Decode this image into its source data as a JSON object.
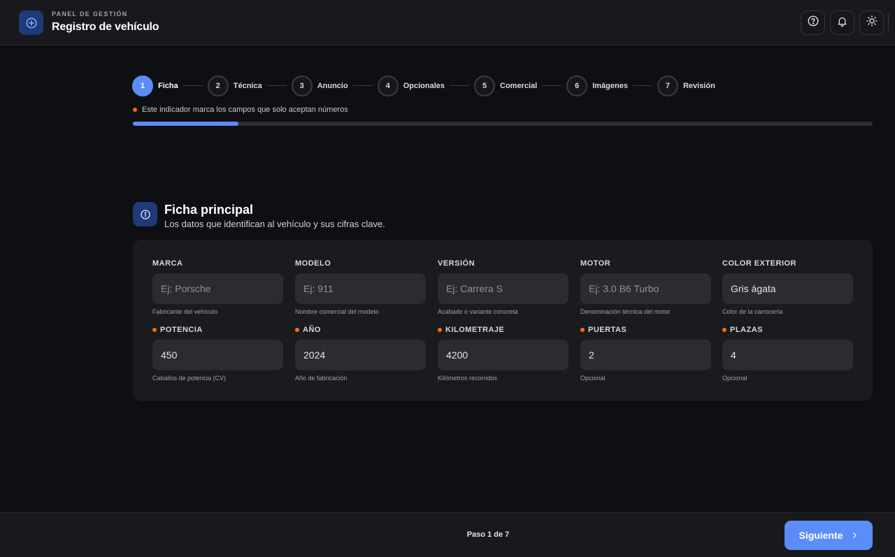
{
  "header": {
    "eyebrow": "PANEL DE GESTIÓN",
    "title": "Registro de vehículo",
    "brand_icon": "plus-circle-icon",
    "actions": [
      {
        "name": "help-button",
        "icon": "help-circle-icon"
      },
      {
        "name": "notifications-button",
        "icon": "bell-icon"
      },
      {
        "name": "theme-toggle-button",
        "icon": "sun-icon"
      }
    ]
  },
  "stepper": {
    "steps": [
      {
        "number": "1",
        "label": "Ficha"
      },
      {
        "number": "2",
        "label": "Técnica"
      },
      {
        "number": "3",
        "label": "Anuncio"
      },
      {
        "number": "4",
        "label": "Opcionales"
      },
      {
        "number": "5",
        "label": "Comercial"
      },
      {
        "number": "6",
        "label": "Imágenes"
      },
      {
        "number": "7",
        "label": "Revisión"
      }
    ],
    "active_index": 0
  },
  "hint": "Este indicador marca los campos que solo aceptan números",
  "progress": {
    "fraction": 0.143
  },
  "section": {
    "icon": "info-icon",
    "title": "Ficha principal",
    "subtitle": "Los datos que identifican al vehículo y sus cifras clave."
  },
  "fields": {
    "marca": {
      "label": "MARCA",
      "numeric": false,
      "value": "",
      "placeholder": "Ej: Porsche",
      "help": "Fabricante del vehículo"
    },
    "modelo": {
      "label": "MODELO",
      "numeric": false,
      "value": "",
      "placeholder": "Ej: 911",
      "help": "Nombre comercial del modelo"
    },
    "version": {
      "label": "VERSIÓN",
      "numeric": false,
      "value": "",
      "placeholder": "Ej: Carrera S",
      "help": "Acabado o variante concreta"
    },
    "motor": {
      "label": "MOTOR",
      "numeric": false,
      "value": "",
      "placeholder": "Ej: 3.0 B6 Turbo",
      "help": "Denominación técnica del motor"
    },
    "color": {
      "label": "COLOR EXTERIOR",
      "numeric": false,
      "value": "Gris ágata",
      "placeholder": "",
      "help": "Color de la carrocería"
    },
    "potencia": {
      "label": "POTENCIA",
      "numeric": true,
      "value": "450",
      "placeholder": "",
      "help": "Caballos de potencia (CV)"
    },
    "anio": {
      "label": "AÑO",
      "numeric": true,
      "value": "2024",
      "placeholder": "",
      "help": "Año de fabricación"
    },
    "kilometraje": {
      "label": "KILOMETRAJE",
      "numeric": true,
      "value": "4200",
      "placeholder": "",
      "help": "Kilómetros recorridos"
    },
    "puertas": {
      "label": "PUERTAS",
      "numeric": true,
      "value": "2",
      "placeholder": "",
      "help": "Opcional"
    },
    "plazas": {
      "label": "PLAZAS",
      "numeric": true,
      "value": "4",
      "placeholder": "",
      "help": "Opcional"
    }
  },
  "footer": {
    "step_count": "Paso 1 de 7",
    "next_label": "Siguiente",
    "next_icon": "chevron-right-icon"
  },
  "colors": {
    "accent": "#5b8cf7",
    "numeric_marker": "#ff6a1a",
    "background": "#0e0f12",
    "surface": "#18191d"
  }
}
